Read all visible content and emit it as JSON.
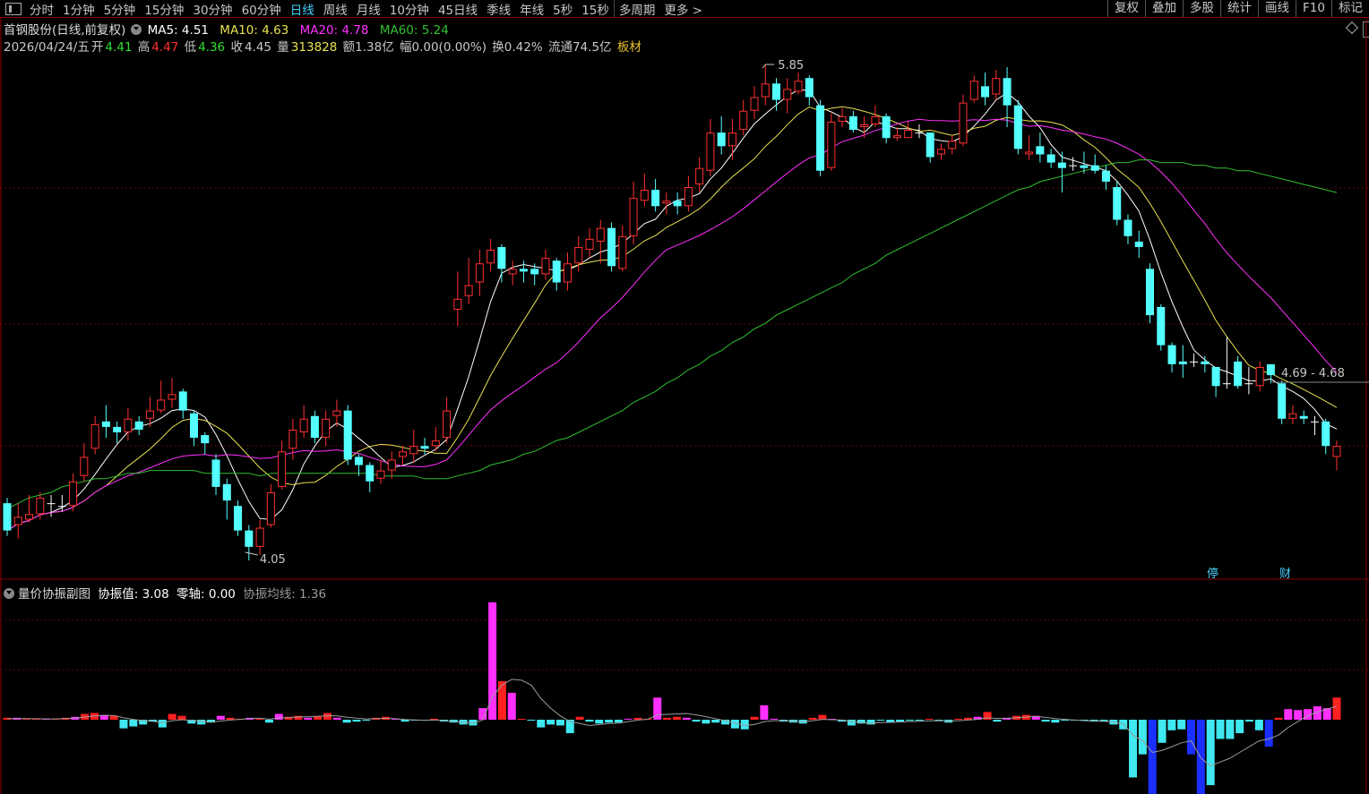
{
  "toolbar": {
    "periods": [
      "分时",
      "1分钟",
      "5分钟",
      "15分钟",
      "30分钟",
      "60分钟",
      "日线",
      "周线",
      "月线",
      "10分钟",
      "45日线",
      "季线",
      "年线",
      "5秒",
      "15秒",
      "多周期",
      "更多 >"
    ],
    "active_period": "日线",
    "buttons": [
      "复权",
      "叠加",
      "多股",
      "统计",
      "画线",
      "F10",
      "标记"
    ]
  },
  "quote": {
    "name": "首钢股份(日线,前复权)",
    "ma5_label": "MA5: 4.51",
    "ma10_label": "MA10: 4.63",
    "ma20_label": "MA20: 4.78",
    "ma60_label": "MA60: 5.24",
    "date": "2026/04/24/五",
    "open_label": "开",
    "open": "4.41",
    "high_label": "高",
    "high": "4.47",
    "low_label": "低",
    "low": "4.36",
    "close_label": "收",
    "close": "4.45",
    "volume_label": "量",
    "volume": "313828",
    "amount": "额1.38亿",
    "change": "幅0.00(0.00%)",
    "turnover": "换0.42%",
    "float_cap": "流通74.5亿",
    "sector": "板材"
  },
  "annotations": {
    "high_mark": "5.85",
    "low_mark": "4.05",
    "range_mark": "4.69 - 4.68",
    "tag_ting": "停",
    "tag_cai": "财"
  },
  "indicator": {
    "name": "量价协振副图",
    "value_label": "协振值: 3.08",
    "zero_label": "零轴: 0.00",
    "avg_label": "协振均线: 1.36"
  },
  "colors": {
    "up": "#ff3030",
    "down": "#54ffff",
    "ma5": "#ffffff",
    "ma10": "#e8e050",
    "ma20": "#ff30ff",
    "ma60": "#30c030",
    "accent": "#47d0ff"
  },
  "chart_data": [
    {
      "type": "candlestick",
      "title": "首钢股份(日线,前复权)",
      "series_names": [
        "MA5",
        "MA10",
        "MA20",
        "MA60"
      ],
      "note_high": 5.85,
      "note_low": 4.05,
      "last_close": 4.45,
      "candles": [
        [
          4.24,
          4.14,
          4.26,
          4.12
        ],
        [
          4.16,
          4.19,
          4.24,
          4.11
        ],
        [
          4.18,
          4.2,
          4.27,
          4.17
        ],
        [
          4.2,
          4.26,
          4.28,
          4.18
        ],
        [
          4.24,
          4.24,
          4.27,
          4.19
        ],
        [
          4.23,
          4.23,
          4.27,
          4.21
        ],
        [
          4.23,
          4.32,
          4.35,
          4.21
        ],
        [
          4.34,
          4.41,
          4.46,
          4.32
        ],
        [
          4.44,
          4.53,
          4.56,
          4.42
        ],
        [
          4.54,
          4.52,
          4.6,
          4.48
        ],
        [
          4.52,
          4.5,
          4.54,
          4.46
        ],
        [
          4.5,
          4.55,
          4.59,
          4.47
        ],
        [
          4.54,
          4.51,
          4.56,
          4.49
        ],
        [
          4.55,
          4.58,
          4.63,
          4.52
        ],
        [
          4.58,
          4.62,
          4.69,
          4.57
        ],
        [
          4.62,
          4.64,
          4.7,
          4.59
        ],
        [
          4.65,
          4.58,
          4.66,
          4.55
        ],
        [
          4.57,
          4.48,
          4.58,
          4.45
        ],
        [
          4.49,
          4.46,
          4.5,
          4.42
        ],
        [
          4.4,
          4.3,
          4.42,
          4.27
        ],
        [
          4.31,
          4.25,
          4.33,
          4.18
        ],
        [
          4.23,
          4.14,
          4.25,
          4.12
        ],
        [
          4.14,
          4.08,
          4.16,
          4.03
        ],
        [
          4.08,
          4.15,
          4.18,
          4.05
        ],
        [
          4.16,
          4.28,
          4.31,
          4.15
        ],
        [
          4.3,
          4.43,
          4.47,
          4.29
        ],
        [
          4.44,
          4.51,
          4.55,
          4.4
        ],
        [
          4.5,
          4.55,
          4.6,
          4.48
        ],
        [
          4.56,
          4.48,
          4.58,
          4.46
        ],
        [
          4.48,
          4.55,
          4.58,
          4.45
        ],
        [
          4.56,
          4.58,
          4.62,
          4.52
        ],
        [
          4.58,
          4.4,
          4.6,
          4.38
        ],
        [
          4.41,
          4.38,
          4.42,
          4.34
        ],
        [
          4.38,
          4.32,
          4.39,
          4.28
        ],
        [
          4.33,
          4.36,
          4.4,
          4.31
        ],
        [
          4.36,
          4.4,
          4.43,
          4.33
        ],
        [
          4.41,
          4.43,
          4.45,
          4.38
        ],
        [
          4.42,
          4.45,
          4.51,
          4.39
        ],
        [
          4.45,
          4.44,
          4.48,
          4.42
        ],
        [
          4.45,
          4.47,
          4.52,
          4.43
        ],
        [
          4.48,
          4.58,
          4.63,
          4.46
        ],
        [
          4.95,
          4.99,
          5.09,
          4.89
        ],
        [
          5.0,
          5.04,
          5.14,
          4.97
        ],
        [
          5.05,
          5.12,
          5.17,
          5.0
        ],
        [
          5.12,
          5.17,
          5.21,
          5.09
        ],
        [
          5.18,
          5.1,
          5.19,
          5.05
        ],
        [
          5.08,
          5.1,
          5.13,
          5.04
        ],
        [
          5.1,
          5.09,
          5.13,
          5.05
        ],
        [
          5.1,
          5.08,
          5.12,
          5.04
        ],
        [
          5.08,
          5.14,
          5.17,
          5.06
        ],
        [
          5.13,
          5.05,
          5.14,
          5.02
        ],
        [
          5.05,
          5.12,
          5.16,
          5.02
        ],
        [
          5.12,
          5.18,
          5.22,
          5.09
        ],
        [
          5.17,
          5.21,
          5.25,
          5.14
        ],
        [
          5.2,
          5.25,
          5.28,
          5.12
        ],
        [
          5.25,
          5.11,
          5.27,
          5.09
        ],
        [
          5.1,
          5.22,
          5.26,
          5.09
        ],
        [
          5.22,
          5.36,
          5.42,
          5.19
        ],
        [
          5.35,
          5.39,
          5.45,
          5.33
        ],
        [
          5.39,
          5.33,
          5.43,
          5.31
        ],
        [
          5.34,
          5.35,
          5.38,
          5.3
        ],
        [
          5.35,
          5.33,
          5.38,
          5.3
        ],
        [
          5.33,
          5.4,
          5.44,
          5.31
        ],
        [
          5.41,
          5.47,
          5.51,
          5.38
        ],
        [
          5.46,
          5.6,
          5.65,
          5.44
        ],
        [
          5.6,
          5.55,
          5.66,
          5.52
        ],
        [
          5.55,
          5.6,
          5.65,
          5.5
        ],
        [
          5.61,
          5.68,
          5.72,
          5.59
        ],
        [
          5.68,
          5.73,
          5.77,
          5.65
        ],
        [
          5.73,
          5.78,
          5.85,
          5.7
        ],
        [
          5.78,
          5.72,
          5.8,
          5.68
        ],
        [
          5.72,
          5.76,
          5.8,
          5.67
        ],
        [
          5.75,
          5.79,
          5.82,
          5.74
        ],
        [
          5.8,
          5.73,
          5.81,
          5.7
        ],
        [
          5.7,
          5.46,
          5.72,
          5.44
        ],
        [
          5.47,
          5.64,
          5.67,
          5.46
        ],
        [
          5.64,
          5.66,
          5.69,
          5.62
        ],
        [
          5.66,
          5.61,
          5.68,
          5.6
        ],
        [
          5.62,
          5.63,
          5.66,
          5.58
        ],
        [
          5.63,
          5.66,
          5.7,
          5.62
        ],
        [
          5.66,
          5.58,
          5.67,
          5.56
        ],
        [
          5.58,
          5.59,
          5.62,
          5.57
        ],
        [
          5.58,
          5.61,
          5.64,
          5.59
        ],
        [
          5.6,
          5.6,
          5.63,
          5.58
        ],
        [
          5.6,
          5.51,
          5.6,
          5.49
        ],
        [
          5.52,
          5.54,
          5.56,
          5.5
        ],
        [
          5.54,
          5.57,
          5.59,
          5.52
        ],
        [
          5.56,
          5.71,
          5.74,
          5.55
        ],
        [
          5.72,
          5.79,
          5.81,
          5.71
        ],
        [
          5.77,
          5.73,
          5.82,
          5.7
        ],
        [
          5.74,
          5.8,
          5.83,
          5.72
        ],
        [
          5.8,
          5.7,
          5.84,
          5.62
        ],
        [
          5.7,
          5.54,
          5.72,
          5.52
        ],
        [
          5.52,
          5.53,
          5.59,
          5.5
        ],
        [
          5.55,
          5.52,
          5.6,
          5.49
        ],
        [
          5.52,
          5.49,
          5.54,
          5.47
        ],
        [
          5.49,
          5.47,
          5.53,
          5.38
        ],
        [
          5.48,
          5.48,
          5.51,
          5.46
        ],
        [
          5.48,
          5.47,
          5.53,
          5.45
        ],
        [
          5.48,
          5.46,
          5.52,
          5.45
        ],
        [
          5.46,
          5.42,
          5.48,
          5.39
        ],
        [
          5.4,
          5.28,
          5.42,
          5.26
        ],
        [
          5.28,
          5.22,
          5.3,
          5.19
        ],
        [
          5.2,
          5.18,
          5.24,
          5.14
        ],
        [
          5.1,
          4.93,
          5.12,
          4.9
        ],
        [
          4.96,
          4.82,
          4.97,
          4.8
        ],
        [
          4.82,
          4.75,
          4.83,
          4.72
        ],
        [
          4.76,
          4.75,
          4.82,
          4.7
        ],
        [
          4.76,
          4.76,
          4.79,
          4.74
        ],
        [
          4.76,
          4.75,
          4.78,
          4.72
        ],
        [
          4.74,
          4.67,
          4.74,
          4.63
        ],
        [
          4.68,
          4.68,
          4.85,
          4.66
        ],
        [
          4.76,
          4.67,
          4.78,
          4.66
        ],
        [
          4.68,
          4.68,
          4.74,
          4.64
        ],
        [
          4.67,
          4.74,
          4.76,
          4.65
        ],
        [
          4.75,
          4.71,
          4.75,
          4.68
        ],
        [
          4.68,
          4.55,
          4.69,
          4.53
        ],
        [
          4.55,
          4.57,
          4.6,
          4.53
        ],
        [
          4.56,
          4.55,
          4.58,
          4.53
        ],
        [
          4.54,
          4.54,
          4.56,
          4.49
        ],
        [
          4.54,
          4.45,
          4.55,
          4.42
        ],
        [
          4.41,
          4.45,
          4.47,
          4.36
        ]
      ],
      "ma60": [
        4.22,
        4.24,
        4.26,
        4.27,
        4.28,
        4.3,
        4.31,
        4.32,
        4.33,
        4.33,
        4.34,
        4.35,
        4.35,
        4.36,
        4.36,
        4.36,
        4.36,
        4.36,
        4.35,
        4.35,
        4.35,
        4.35,
        4.35,
        4.34,
        4.35,
        4.35,
        4.35,
        4.35,
        4.35,
        4.35,
        4.35,
        4.35,
        4.35,
        4.35,
        4.34,
        4.34,
        4.34,
        4.34,
        4.33,
        4.33,
        4.33,
        4.34,
        4.35,
        4.36,
        4.38,
        4.39,
        4.4,
        4.42,
        4.43,
        4.45,
        4.47,
        4.48,
        4.5,
        4.52,
        4.54,
        4.56,
        4.58,
        4.61,
        4.63,
        4.65,
        4.68,
        4.7,
        4.73,
        4.75,
        4.78,
        4.8,
        4.83,
        4.85,
        4.88,
        4.9,
        4.93,
        4.95,
        4.97,
        4.99,
        5.01,
        5.03,
        5.05,
        5.08,
        5.1,
        5.12,
        5.15,
        5.17,
        5.19,
        5.21,
        5.23,
        5.25,
        5.27,
        5.29,
        5.31,
        5.33,
        5.35,
        5.37,
        5.39,
        5.4,
        5.42,
        5.43,
        5.44,
        5.45,
        5.46,
        5.47,
        5.48,
        5.49,
        5.49,
        5.5,
        5.5,
        5.49,
        5.49,
        5.49,
        5.48,
        5.48,
        5.47,
        5.47,
        5.46,
        5.46,
        5.45,
        5.44,
        5.43,
        5.42,
        5.41,
        5.4,
        5.39,
        5.38
      ]
    },
    {
      "type": "bar",
      "title": "量价协振副图",
      "values": [
        0.1,
        0.1,
        0.05,
        0,
        0,
        0,
        0.1,
        0.15,
        0.3,
        0.35,
        0.25,
        0.2,
        -0.45,
        -0.35,
        -0.25,
        -0.1,
        -0.4,
        0.3,
        0.2,
        -0.2,
        -0.25,
        -0.15,
        0.2,
        0.1,
        0.05,
        0.1,
        0.05,
        -0.15,
        0.3,
        0.15,
        0.2,
        0.1,
        0.2,
        0.35,
        0.1,
        -0.15,
        -0.1,
        -0.05,
        0.1,
        0.15,
        0,
        -0.1,
        -0.05,
        -0.05,
        0,
        -0.1,
        -0.15,
        -0.25,
        -0.3,
        0.6,
        6.1,
        2.0,
        1.4,
        0,
        -0.05,
        -0.4,
        -0.25,
        -0.3,
        -0.7,
        0.15,
        -0.1,
        -0.2,
        -0.15,
        -0.15,
        0.05,
        0.1,
        0.05,
        1.15,
        0.1,
        0.15,
        0.1,
        -0.1,
        -0.2,
        -0.15,
        -0.25,
        -0.45,
        -0.5,
        0.15,
        0.75,
        0.05,
        -0.1,
        -0.15,
        -0.2,
        0.1,
        0.25,
        0,
        -0.1,
        -0.3,
        -0.2,
        -0.25,
        -0.05,
        -0.15,
        -0.1,
        -0.05,
        -0.05,
        0,
        -0.05,
        -0.15,
        0,
        0.1,
        0.15,
        0.4,
        -0.1,
        0.1,
        0.2,
        0.25,
        0.2,
        -0.1,
        -0.15,
        -0.05,
        -0.05,
        -0.05,
        -0.1,
        -0.1,
        -0.25,
        -0.5,
        -3.0,
        -1.8,
        -4.1,
        -1.2,
        -0.55,
        -0.5,
        -1.8,
        -5.6,
        -3.4,
        -1.0,
        -1.0,
        -0.7,
        -0.1,
        -0.55,
        -1.4,
        0.1,
        0.55,
        0.5,
        0.55,
        0.7,
        0.6,
        1.15
      ],
      "avg": [
        0.05,
        0.06,
        0.06,
        0.05,
        0.04,
        0.04,
        0.06,
        0.09,
        0.14,
        0.2,
        0.22,
        0.22,
        0.1,
        0.02,
        -0.05,
        -0.08,
        -0.15,
        -0.06,
        0.0,
        -0.04,
        -0.09,
        -0.13,
        -0.07,
        -0.02,
        0.02,
        0.06,
        0.08,
        0.03,
        0.09,
        0.11,
        0.15,
        0.15,
        0.17,
        0.21,
        0.2,
        0.13,
        0.08,
        0.04,
        0.06,
        0.07,
        0.05,
        0.01,
        -0.01,
        -0.03,
        -0.02,
        -0.05,
        -0.09,
        -0.14,
        -0.18,
        -0.02,
        1.2,
        1.8,
        2.1,
        2.05,
        1.8,
        1.1,
        0.6,
        0.2,
        -0.1,
        -0.2,
        -0.3,
        -0.25,
        -0.2,
        -0.18,
        -0.1,
        -0.02,
        0.02,
        0.25,
        0.28,
        0.3,
        0.32,
        0.25,
        0.16,
        0.05,
        -0.05,
        -0.18,
        -0.3,
        -0.25,
        -0.1,
        -0.05,
        -0.05,
        -0.08,
        -0.1,
        -0.06,
        0.02,
        0.0,
        -0.02,
        -0.1,
        -0.14,
        -0.18,
        -0.15,
        -0.14,
        -0.12,
        -0.1,
        -0.08,
        -0.06,
        -0.05,
        -0.07,
        -0.05,
        -0.02,
        0.02,
        0.1,
        0.07,
        0.07,
        0.1,
        0.14,
        0.17,
        0.12,
        0.06,
        0.02,
        -0.02,
        -0.05,
        -0.07,
        -0.08,
        -0.12,
        -0.22,
        -0.8,
        -1.1,
        -1.7,
        -1.6,
        -1.4,
        -1.2,
        -1.1,
        -2.0,
        -2.4,
        -2.2,
        -2.0,
        -1.7,
        -1.4,
        -1.1,
        -1.0,
        -0.8,
        -0.4,
        -0.1,
        0.2,
        0.4,
        0.55,
        0.7
      ]
    }
  ]
}
